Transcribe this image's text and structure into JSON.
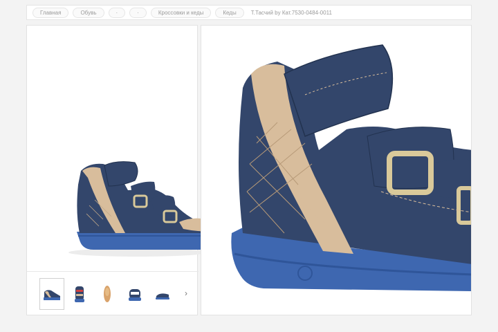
{
  "breadcrumb": {
    "items": [
      {
        "label": "Главная"
      },
      {
        "label": "Обувь"
      },
      {
        "label": "·"
      },
      {
        "label": "·"
      },
      {
        "label": "Кроссовки и кеды"
      },
      {
        "label": "Кеды"
      },
      {
        "label": "Т.Тасчий by Кат.7530-0484-0011"
      }
    ]
  },
  "product": {
    "main_image": "blue-leather-sandal-side-view",
    "zoom_image": "sandal-close-up",
    "thumbnails": [
      {
        "icon": "sandal-side-thumb",
        "active": true
      },
      {
        "icon": "sandal-front-thumb",
        "active": false
      },
      {
        "icon": "insole-thumb",
        "active": false
      },
      {
        "icon": "sandal-top-thumb",
        "active": false
      },
      {
        "icon": "sandal-back-thumb",
        "active": false
      }
    ],
    "next_arrow": "›"
  },
  "colors": {
    "shoe_navy": "#33466b",
    "sole_blue": "#3e67b0",
    "trim_beige": "#d8bd9c",
    "buckle": "#d9c99a"
  }
}
